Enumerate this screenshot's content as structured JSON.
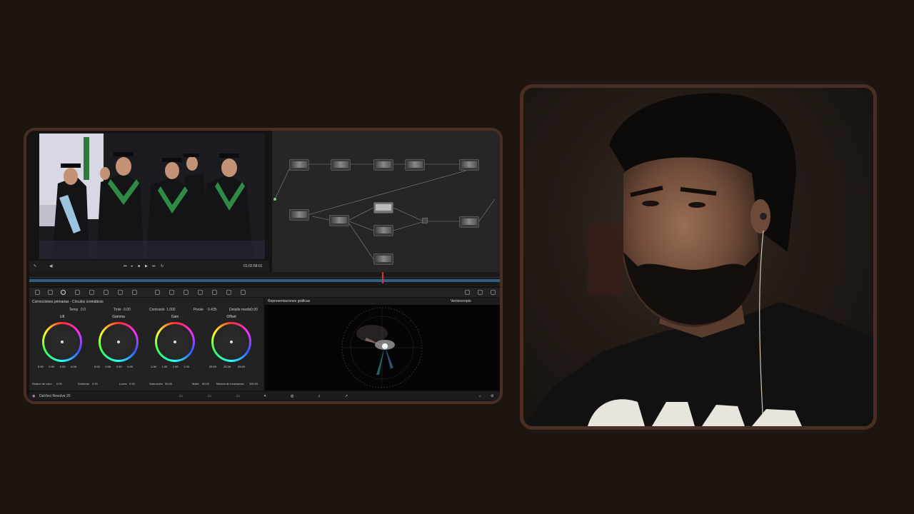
{
  "viewer": {
    "timecode": "01:02:58:01"
  },
  "primaries": {
    "panel_title": "Correcciones primarias - Círculos cromáticos",
    "params_top": [
      {
        "label": "Temp",
        "value": "0.0"
      },
      {
        "label": "Tinte",
        "value": "0.00"
      },
      {
        "label": "Contraste",
        "value": "1.000"
      },
      {
        "label": "Pivote",
        "value": "0.435"
      },
      {
        "label": "Detalle medio",
        "value": "0.00"
      }
    ],
    "wheels": [
      {
        "label": "Lift",
        "values": [
          "0.00",
          "0.00",
          "0.00",
          "0.00"
        ]
      },
      {
        "label": "Gamma",
        "values": [
          "0.00",
          "0.00",
          "0.00",
          "0.00"
        ]
      },
      {
        "label": "Gain",
        "values": [
          "1.00",
          "1.00",
          "1.00",
          "1.00"
        ]
      },
      {
        "label": "Offset",
        "values": [
          "25.00",
          "25.00",
          "25.00"
        ]
      }
    ],
    "params_bottom": [
      {
        "label": "Realce de color",
        "value": "0.00"
      },
      {
        "label": "Sombras",
        "value": "0.00"
      },
      {
        "label": "Luces",
        "value": "0.00"
      },
      {
        "label": "Saturación",
        "value": "50.00"
      },
      {
        "label": "Matiz",
        "value": "50.00"
      },
      {
        "label": "Mezcla de luminancia",
        "value": "100.00"
      }
    ]
  },
  "scopes": {
    "title": "Representaciones gráficas",
    "mode": "Vectorscopio"
  },
  "statusbar": {
    "app_name": "DaVinci Resolve 20"
  },
  "colors": {
    "frame_border": "#4a2e24",
    "background": "#1e1410"
  }
}
